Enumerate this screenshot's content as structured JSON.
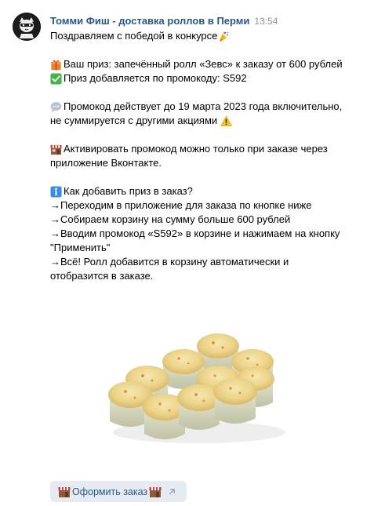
{
  "post": {
    "author": "Томми Фиш - доставка роллов в Перми",
    "time": "13:54",
    "lines": {
      "l1": "Поздравляем с победой в конкурсе",
      "l2": "Ваш приз: запечённый ролл «Зевс» к заказу от 600 рублей",
      "l3": "Приз добавляется по промокоду: S592",
      "l4": "Промокод действует до 19 марта 2023 года включительно,",
      "l5": "не суммируется с другими акциями",
      "l6": "Активировать промокод можно только при заказе через",
      "l7": "приложение Вконтакте.",
      "l8": "Как добавить приз в заказ?",
      "l9": "→Переходим в приложение для заказа по кнопке ниже",
      "l10": "→Собираем корзину на сумму больше 600 рублей",
      "l11": "→Вводим промокод «S592» в корзине и нажимаем на кнопку",
      "l12": "\"Применить\"",
      "l13": "→Всё! Ролл добавится в корзину автоматически и",
      "l14": "отобразится в заказе."
    }
  },
  "button": {
    "label": "Оформить заказ"
  },
  "icons": {
    "party": "party-popper-icon",
    "gift": "gift-icon",
    "check": "check-mark-icon",
    "speech": "speech-bubble-icon",
    "warning": "warning-icon",
    "shop": "shop-icon",
    "info": "info-icon",
    "external": "external-link-arrow-icon"
  },
  "colors": {
    "author": "#2a5885",
    "time": "#939393",
    "button_bg": "#e5ebf1",
    "check": "#44b34a",
    "info": "#3a8ee6",
    "warning": "#f5c518"
  }
}
